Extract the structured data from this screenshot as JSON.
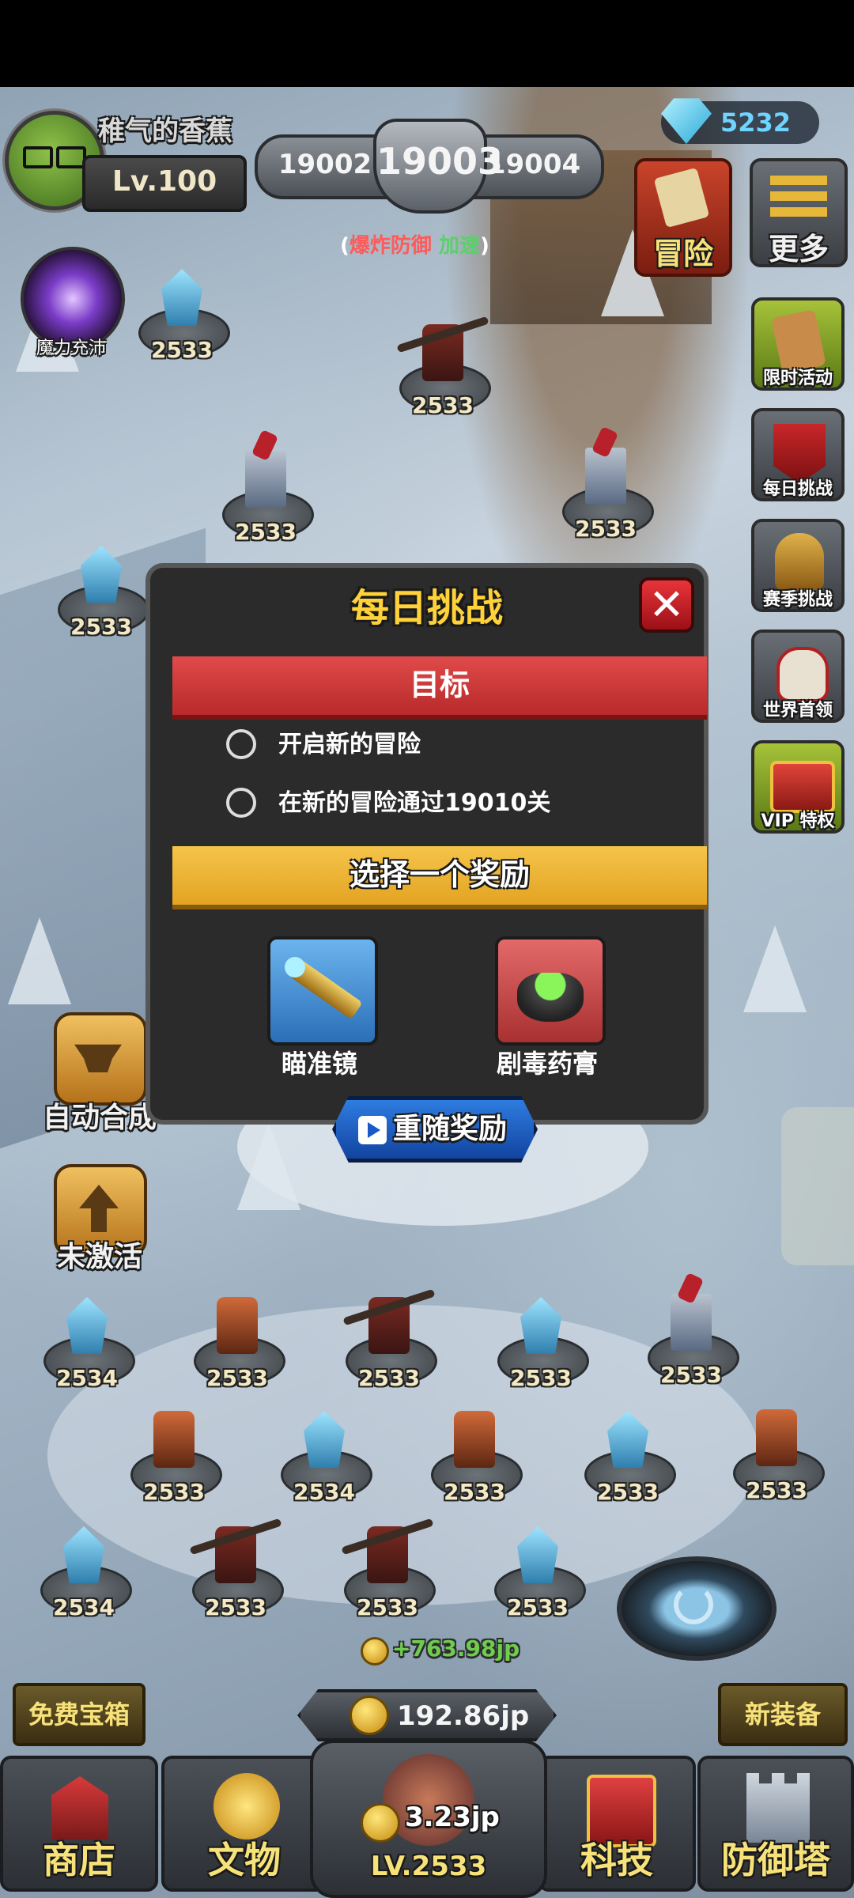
{
  "player": {
    "name": "稚气的香蕉",
    "level": "Lv.100"
  },
  "stages": {
    "prev": "19002",
    "current": "19003",
    "next": "19004"
  },
  "stage_modifier": {
    "prefix": "(",
    "part1": "爆炸防御",
    "part2": "加速",
    "suffix": ")"
  },
  "gems": "5232",
  "left_buttons": {
    "mana": "魔力充沛",
    "auto_merge": "自动合成",
    "inactive": "未激活"
  },
  "top_right": {
    "adventure": "冒险",
    "more": "更多"
  },
  "side_menu": [
    {
      "label": "限时活动",
      "icon": "scroll-icon"
    },
    {
      "label": "每日挑战",
      "icon": "crossed-swords-icon"
    },
    {
      "label": "赛季挑战",
      "icon": "helmet-icon"
    },
    {
      "label": "世界首领",
      "icon": "skull-icon"
    },
    {
      "label": "VIP 特权",
      "icon": "chest-icon"
    }
  ],
  "map_towers_top": [
    "2533",
    "2533",
    "2533",
    "2533",
    "2533",
    "2533"
  ],
  "grid_towers": {
    "row1": [
      "2534",
      "2533",
      "2533",
      "2533",
      "2533"
    ],
    "row2": [
      "2533",
      "2534",
      "2533",
      "2533",
      "2533"
    ],
    "row3": [
      "2534",
      "2533",
      "2533",
      "2533"
    ]
  },
  "floating_income": "+763.98jp",
  "modal": {
    "title": "每日挑战",
    "goal_header": "目标",
    "objectives": [
      "开启新的冒险",
      "在新的冒险通过19010关"
    ],
    "reward_header": "选择一个奖励",
    "rewards": [
      {
        "label": "瞄准镜",
        "icon": "spyglass-icon"
      },
      {
        "label": "剧毒药膏",
        "icon": "poison-cauldron-icon"
      }
    ],
    "reroll_label": "重随奖励"
  },
  "bottom": {
    "free_chest": "免费宝箱",
    "new_equipment": "新装备",
    "gold": "192.86jp",
    "nav": {
      "shop": "商店",
      "artifacts": "文物",
      "tech": "科技",
      "towers": "防御塔"
    },
    "buy_cost": "3.23jp",
    "buy_level": "LV.2533"
  },
  "colors": {
    "goal_ribbon": "#d43c3c",
    "reward_ribbon": "#f0b43a",
    "title_yellow": "#ffd23a",
    "close_red": "#c8202a"
  }
}
